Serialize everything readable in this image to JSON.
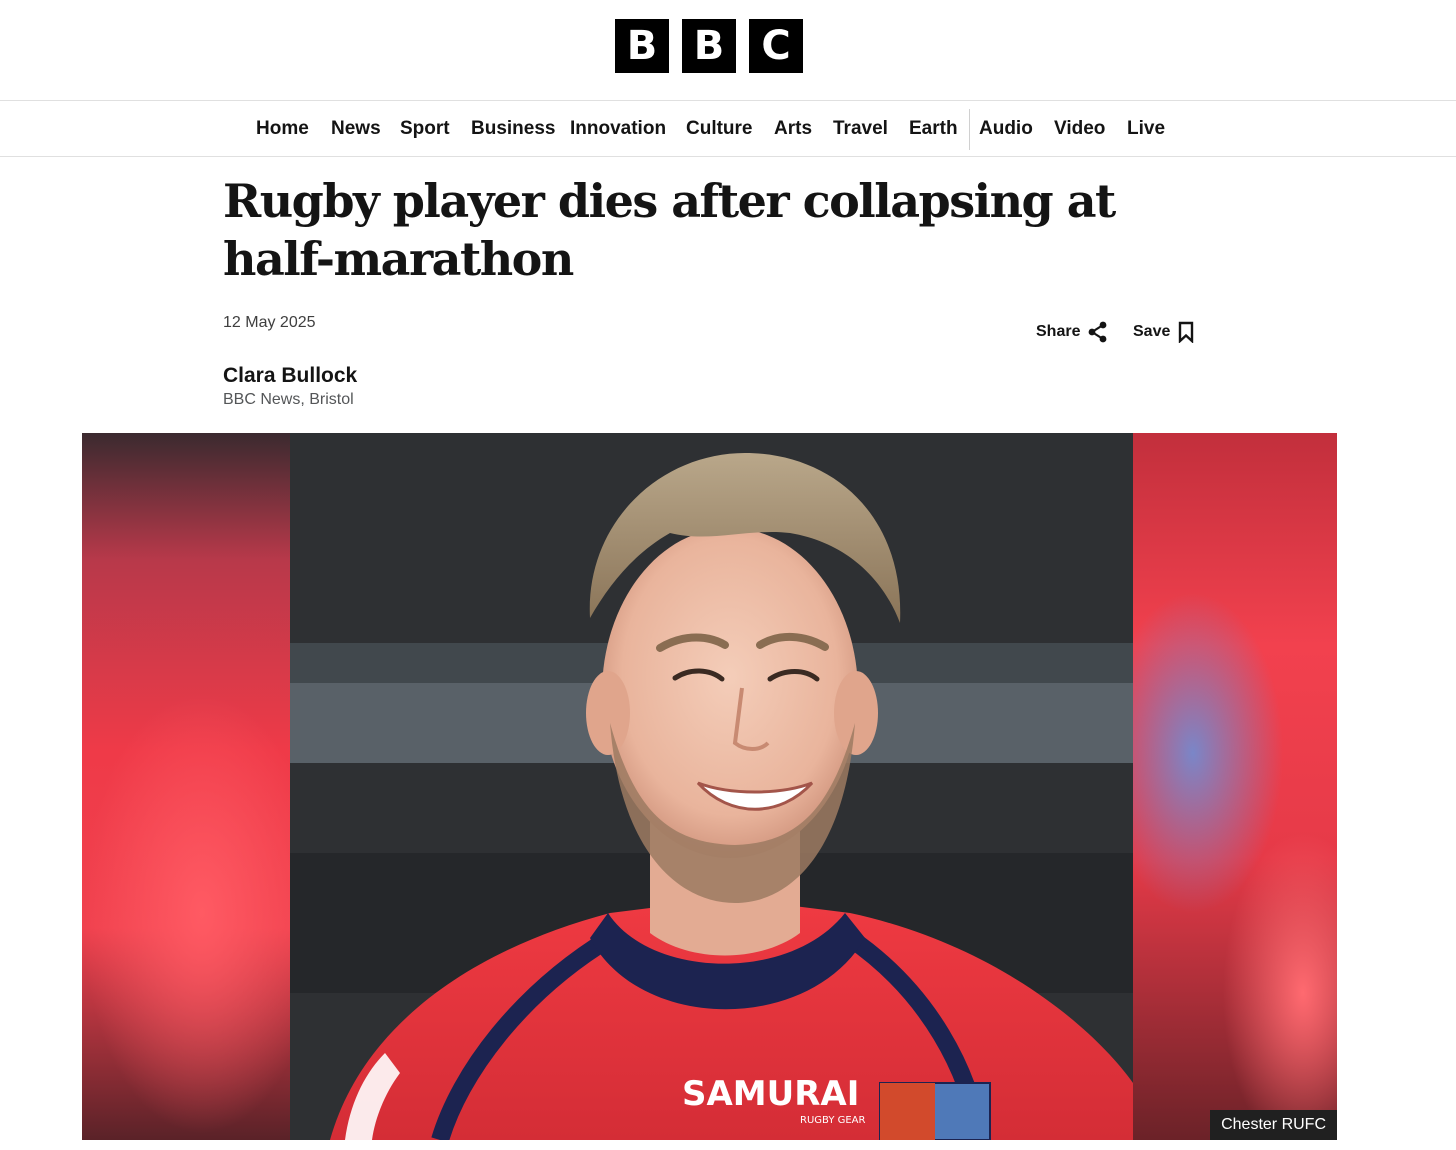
{
  "brand": {
    "letters": [
      "B",
      "B",
      "C"
    ]
  },
  "nav": {
    "items": [
      {
        "label": "Home"
      },
      {
        "label": "News"
      },
      {
        "label": "Sport"
      },
      {
        "label": "Business"
      },
      {
        "label": "Innovation"
      },
      {
        "label": "Culture"
      },
      {
        "label": "Arts"
      },
      {
        "label": "Travel"
      },
      {
        "label": "Earth"
      },
      {
        "label": "Audio"
      },
      {
        "label": "Video"
      },
      {
        "label": "Live"
      }
    ]
  },
  "article": {
    "headline": "Rugby player dies after collapsing at half-marathon",
    "date": "12 May 2025",
    "author": "Clara Bullock",
    "affiliation": "BBC News, Bristol",
    "share_label": "Share",
    "save_label": "Save"
  },
  "image": {
    "caption": "Chester RUFC",
    "shirt_sponsor": "SAMURAI",
    "shirt_sponsor_sub": "RUGBY GEAR"
  },
  "colors": {
    "text": "#141414",
    "shirt_red": "#e8343c",
    "shirt_navy": "#1c2350",
    "caption_bg": "#202020"
  },
  "icons": [
    "share-icon",
    "bookmark-icon"
  ]
}
